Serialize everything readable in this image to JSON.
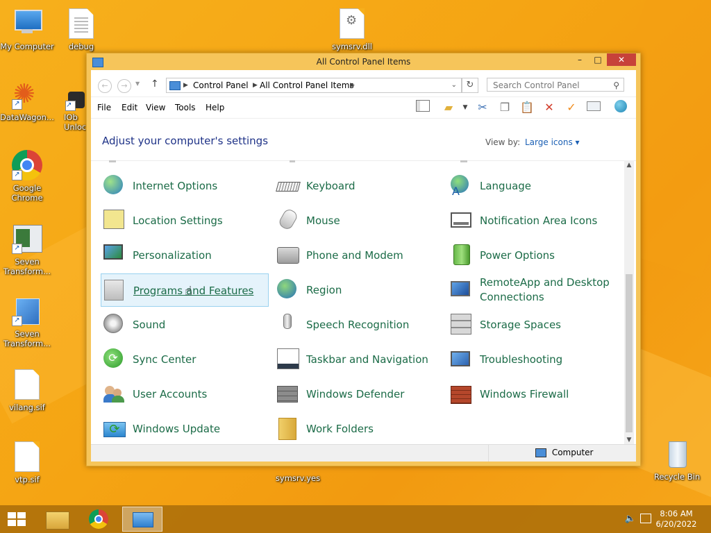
{
  "desktop": {
    "icons": [
      {
        "label": "My Computer"
      },
      {
        "label": "debug"
      },
      {
        "label": "symsrv.dll"
      },
      {
        "label": "DataWagon..."
      },
      {
        "label": "IOb\nUnloc"
      },
      {
        "label": "Google\nChrome"
      },
      {
        "label": "Seven\nTransform..."
      },
      {
        "label": "Seven\nTransform..."
      },
      {
        "label": "vilang.sif"
      },
      {
        "label": "vtp.sif"
      },
      {
        "label": "symsrv.yes"
      },
      {
        "label": "Recycle Bin"
      }
    ]
  },
  "window": {
    "title": "All Control Panel Items",
    "buttons": {
      "minimize": "–",
      "maximize": "□",
      "close": "✕"
    },
    "address": {
      "crumbs": [
        "Control Panel",
        "All Control Panel Items"
      ]
    },
    "search_placeholder": "Search Control Panel",
    "menu": [
      "File",
      "Edit",
      "View",
      "Tools",
      "Help"
    ],
    "toolbar_icons": [
      "layout-icon",
      "folder-icon",
      "cut-icon",
      "copy-icon",
      "paste-icon",
      "delete-icon",
      "check-icon",
      "properties-icon",
      "globe-icon"
    ],
    "header": {
      "title": "Adjust your computer's settings",
      "view_by_label": "View by:",
      "view_by_value": "Large icons ▾"
    },
    "items": [
      [
        {
          "label": "Internet Options",
          "icon": "internet-options-icon"
        },
        {
          "label": "Location Settings",
          "icon": "location-settings-icon"
        },
        {
          "label": "Personalization",
          "icon": "personalization-icon"
        },
        {
          "label": "Programs and Features",
          "icon": "programs-features-icon",
          "selected": true
        },
        {
          "label": "Sound",
          "icon": "sound-icon"
        },
        {
          "label": "Sync Center",
          "icon": "sync-center-icon"
        },
        {
          "label": "User Accounts",
          "icon": "user-accounts-icon"
        },
        {
          "label": "Windows Update",
          "icon": "windows-update-icon"
        }
      ],
      [
        {
          "label": "Keyboard",
          "icon": "keyboard-icon"
        },
        {
          "label": "Mouse",
          "icon": "mouse-icon"
        },
        {
          "label": "Phone and Modem",
          "icon": "phone-modem-icon"
        },
        {
          "label": "Region",
          "icon": "region-icon"
        },
        {
          "label": "Speech Recognition",
          "icon": "speech-recognition-icon"
        },
        {
          "label": "Taskbar and Navigation",
          "icon": "taskbar-navigation-icon"
        },
        {
          "label": "Windows Defender",
          "icon": "windows-defender-icon"
        },
        {
          "label": "Work Folders",
          "icon": "work-folders-icon"
        }
      ],
      [
        {
          "label": "Language",
          "icon": "language-icon"
        },
        {
          "label": "Notification Area Icons",
          "icon": "notification-area-icon"
        },
        {
          "label": "Power Options",
          "icon": "power-options-icon"
        },
        {
          "label": "RemoteApp and Desktop Connections",
          "icon": "remoteapp-icon"
        },
        {
          "label": "Storage Spaces",
          "icon": "storage-spaces-icon"
        },
        {
          "label": "Troubleshooting",
          "icon": "troubleshooting-icon"
        },
        {
          "label": "Windows Firewall",
          "icon": "windows-firewall-icon"
        }
      ]
    ],
    "status": {
      "computer_label": "Computer"
    }
  },
  "taskbar": {
    "clock_time": "8:06 AM",
    "clock_date": "6/20/2022"
  }
}
